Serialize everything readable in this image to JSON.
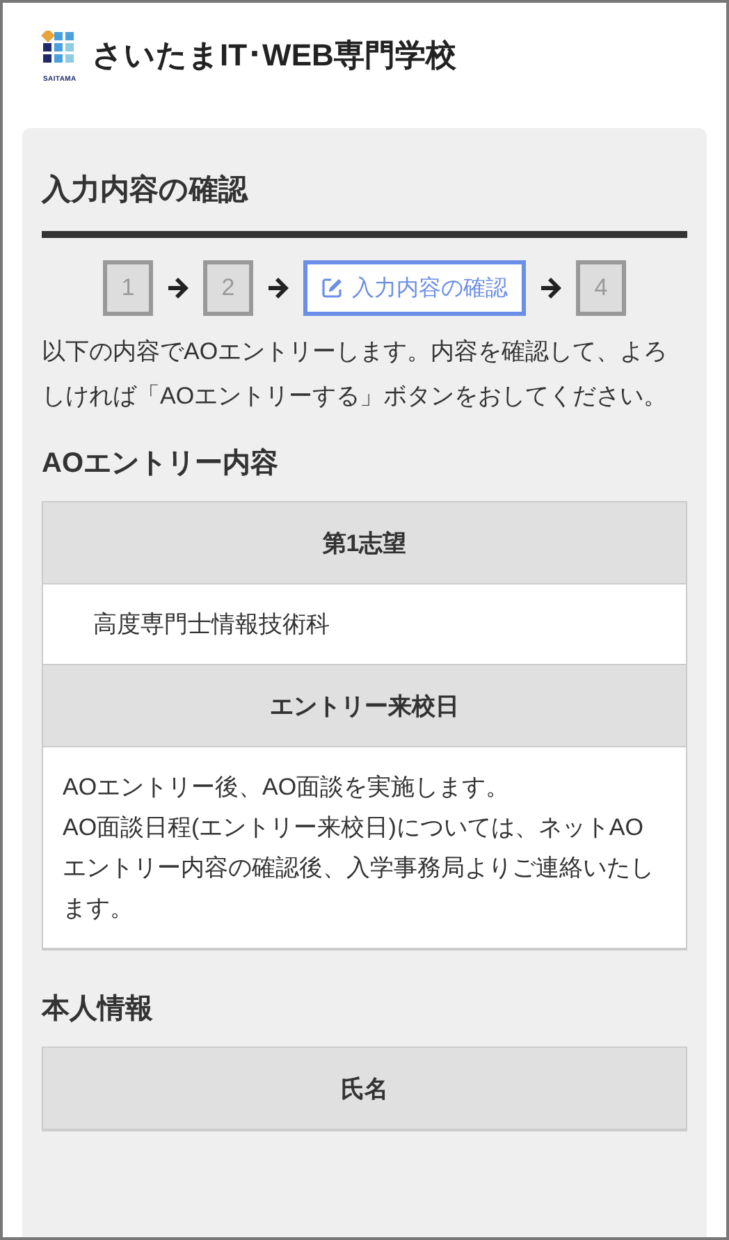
{
  "header": {
    "logo_caption": "SAITAMA",
    "school_name": "さいたまIT･WEB専門学校"
  },
  "page_title": "入力内容の確認",
  "steps": [
    {
      "kind": "number",
      "label": "1",
      "selected": false
    },
    {
      "kind": "number",
      "label": "2",
      "selected": false
    },
    {
      "kind": "current",
      "label": "入力内容の確認",
      "selected": true
    },
    {
      "kind": "number",
      "label": "4",
      "selected": false
    }
  ],
  "intro": "以下の内容でAOエントリーします。内容を確認して、よろしければ「AOエントリーする」ボタンをおしてください。",
  "sections": [
    {
      "heading": "AOエントリー内容",
      "rows": [
        {
          "kind": "header",
          "text": "第1志望"
        },
        {
          "kind": "value",
          "text": "高度専門士情報技術科"
        },
        {
          "kind": "header",
          "text": "エントリー来校日"
        },
        {
          "kind": "note",
          "text": "AOエントリー後、AO面談を実施します。\nAO面談日程(エントリー来校日)については、ネットAOエントリー内容の確認後、入学事務局よりご連絡いたします。"
        }
      ]
    },
    {
      "heading": "本人情報",
      "rows": [
        {
          "kind": "header",
          "text": "氏名"
        }
      ]
    }
  ]
}
